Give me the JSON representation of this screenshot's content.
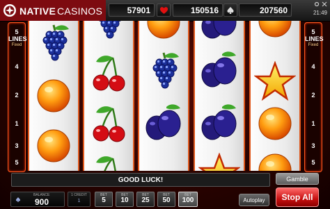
{
  "brand": {
    "name_bold": "NATIVE",
    "name_rest": "CASINOS"
  },
  "top": {
    "jackpot_1": "57901",
    "jackpot_2": "150516",
    "jackpot_3": "207560",
    "clock": "21:49"
  },
  "lines_panel": {
    "title": "5 LINES",
    "subtitle": "Fixed",
    "numbers": [
      "4",
      "2",
      "1",
      "3",
      "5"
    ]
  },
  "reels": [
    [
      "grapes",
      "orange",
      "orange"
    ],
    [
      "grapes",
      "cherries",
      "cherries",
      "cherries"
    ],
    [
      "orange",
      "grapes",
      "plum"
    ],
    [
      "plum",
      "plum",
      "plum",
      "star"
    ],
    [
      "orange",
      "star",
      "orange",
      "orange"
    ]
  ],
  "message": "GOOD LUCK!",
  "controls": {
    "gamble": "Gamble",
    "balance_label": "BALANCE",
    "balance": "900",
    "credit_label": "1 CREDIT",
    "credit_value": "1",
    "bet_label": "BET",
    "bets": [
      "5",
      "10",
      "25",
      "50",
      "100"
    ],
    "selected_bet": "100",
    "autoplay": "Autoplay",
    "stop_all": "Stop All"
  },
  "colors": {
    "reel_border": "#e0571b",
    "panel_border": "#ff5a20",
    "stop_button": "#c70f0f"
  }
}
